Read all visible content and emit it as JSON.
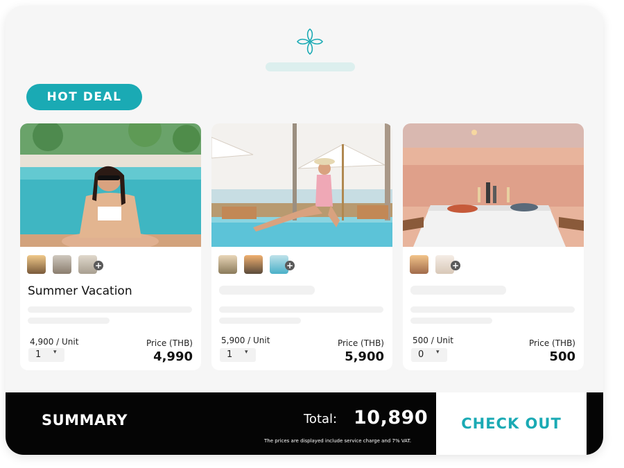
{
  "brand": {
    "logo_icon": "flower-logo-icon",
    "accent": "#1aaab4"
  },
  "badge": {
    "label": "HOT DEAL"
  },
  "cards": [
    {
      "title": "Summer Vacation",
      "unit_price": "4,900 / Unit",
      "quantity": "1",
      "price_label": "Price (THB)",
      "price": "4,990"
    },
    {
      "title": "",
      "unit_price": "5,900 / Unit",
      "quantity": "1",
      "price_label": "Price (THB)",
      "price": "5,900"
    },
    {
      "title": "",
      "unit_price": "500 / Unit",
      "quantity": "0",
      "price_label": "Price (THB)",
      "price": "500"
    }
  ],
  "summary": {
    "label": "SUMMARY",
    "total_label": "Total:",
    "total_value": "10,890",
    "note": "The prices are displayed include service charge and 7% VAT.",
    "checkout_label": "CHECK OUT"
  }
}
